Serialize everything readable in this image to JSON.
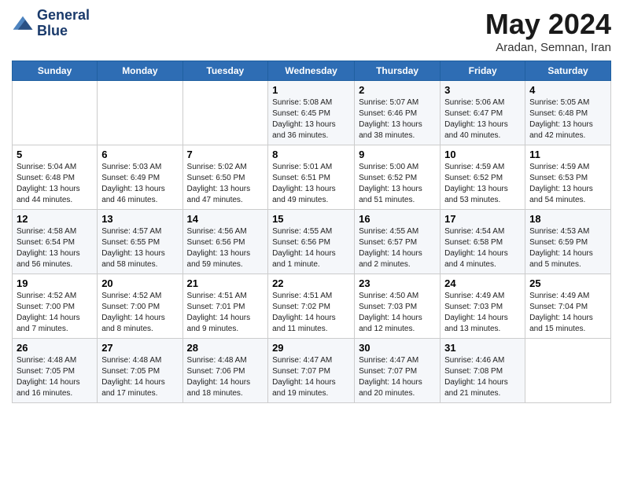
{
  "header": {
    "logo_line1": "General",
    "logo_line2": "Blue",
    "month_title": "May 2024",
    "location": "Aradan, Semnan, Iran"
  },
  "weekdays": [
    "Sunday",
    "Monday",
    "Tuesday",
    "Wednesday",
    "Thursday",
    "Friday",
    "Saturday"
  ],
  "weeks": [
    [
      {
        "day": "",
        "info": ""
      },
      {
        "day": "",
        "info": ""
      },
      {
        "day": "",
        "info": ""
      },
      {
        "day": "1",
        "info": "Sunrise: 5:08 AM\nSunset: 6:45 PM\nDaylight: 13 hours and 36 minutes."
      },
      {
        "day": "2",
        "info": "Sunrise: 5:07 AM\nSunset: 6:46 PM\nDaylight: 13 hours and 38 minutes."
      },
      {
        "day": "3",
        "info": "Sunrise: 5:06 AM\nSunset: 6:47 PM\nDaylight: 13 hours and 40 minutes."
      },
      {
        "day": "4",
        "info": "Sunrise: 5:05 AM\nSunset: 6:48 PM\nDaylight: 13 hours and 42 minutes."
      }
    ],
    [
      {
        "day": "5",
        "info": "Sunrise: 5:04 AM\nSunset: 6:48 PM\nDaylight: 13 hours and 44 minutes."
      },
      {
        "day": "6",
        "info": "Sunrise: 5:03 AM\nSunset: 6:49 PM\nDaylight: 13 hours and 46 minutes."
      },
      {
        "day": "7",
        "info": "Sunrise: 5:02 AM\nSunset: 6:50 PM\nDaylight: 13 hours and 47 minutes."
      },
      {
        "day": "8",
        "info": "Sunrise: 5:01 AM\nSunset: 6:51 PM\nDaylight: 13 hours and 49 minutes."
      },
      {
        "day": "9",
        "info": "Sunrise: 5:00 AM\nSunset: 6:52 PM\nDaylight: 13 hours and 51 minutes."
      },
      {
        "day": "10",
        "info": "Sunrise: 4:59 AM\nSunset: 6:52 PM\nDaylight: 13 hours and 53 minutes."
      },
      {
        "day": "11",
        "info": "Sunrise: 4:59 AM\nSunset: 6:53 PM\nDaylight: 13 hours and 54 minutes."
      }
    ],
    [
      {
        "day": "12",
        "info": "Sunrise: 4:58 AM\nSunset: 6:54 PM\nDaylight: 13 hours and 56 minutes."
      },
      {
        "day": "13",
        "info": "Sunrise: 4:57 AM\nSunset: 6:55 PM\nDaylight: 13 hours and 58 minutes."
      },
      {
        "day": "14",
        "info": "Sunrise: 4:56 AM\nSunset: 6:56 PM\nDaylight: 13 hours and 59 minutes."
      },
      {
        "day": "15",
        "info": "Sunrise: 4:55 AM\nSunset: 6:56 PM\nDaylight: 14 hours and 1 minute."
      },
      {
        "day": "16",
        "info": "Sunrise: 4:55 AM\nSunset: 6:57 PM\nDaylight: 14 hours and 2 minutes."
      },
      {
        "day": "17",
        "info": "Sunrise: 4:54 AM\nSunset: 6:58 PM\nDaylight: 14 hours and 4 minutes."
      },
      {
        "day": "18",
        "info": "Sunrise: 4:53 AM\nSunset: 6:59 PM\nDaylight: 14 hours and 5 minutes."
      }
    ],
    [
      {
        "day": "19",
        "info": "Sunrise: 4:52 AM\nSunset: 7:00 PM\nDaylight: 14 hours and 7 minutes."
      },
      {
        "day": "20",
        "info": "Sunrise: 4:52 AM\nSunset: 7:00 PM\nDaylight: 14 hours and 8 minutes."
      },
      {
        "day": "21",
        "info": "Sunrise: 4:51 AM\nSunset: 7:01 PM\nDaylight: 14 hours and 9 minutes."
      },
      {
        "day": "22",
        "info": "Sunrise: 4:51 AM\nSunset: 7:02 PM\nDaylight: 14 hours and 11 minutes."
      },
      {
        "day": "23",
        "info": "Sunrise: 4:50 AM\nSunset: 7:03 PM\nDaylight: 14 hours and 12 minutes."
      },
      {
        "day": "24",
        "info": "Sunrise: 4:49 AM\nSunset: 7:03 PM\nDaylight: 14 hours and 13 minutes."
      },
      {
        "day": "25",
        "info": "Sunrise: 4:49 AM\nSunset: 7:04 PM\nDaylight: 14 hours and 15 minutes."
      }
    ],
    [
      {
        "day": "26",
        "info": "Sunrise: 4:48 AM\nSunset: 7:05 PM\nDaylight: 14 hours and 16 minutes."
      },
      {
        "day": "27",
        "info": "Sunrise: 4:48 AM\nSunset: 7:05 PM\nDaylight: 14 hours and 17 minutes."
      },
      {
        "day": "28",
        "info": "Sunrise: 4:48 AM\nSunset: 7:06 PM\nDaylight: 14 hours and 18 minutes."
      },
      {
        "day": "29",
        "info": "Sunrise: 4:47 AM\nSunset: 7:07 PM\nDaylight: 14 hours and 19 minutes."
      },
      {
        "day": "30",
        "info": "Sunrise: 4:47 AM\nSunset: 7:07 PM\nDaylight: 14 hours and 20 minutes."
      },
      {
        "day": "31",
        "info": "Sunrise: 4:46 AM\nSunset: 7:08 PM\nDaylight: 14 hours and 21 minutes."
      },
      {
        "day": "",
        "info": ""
      }
    ]
  ]
}
